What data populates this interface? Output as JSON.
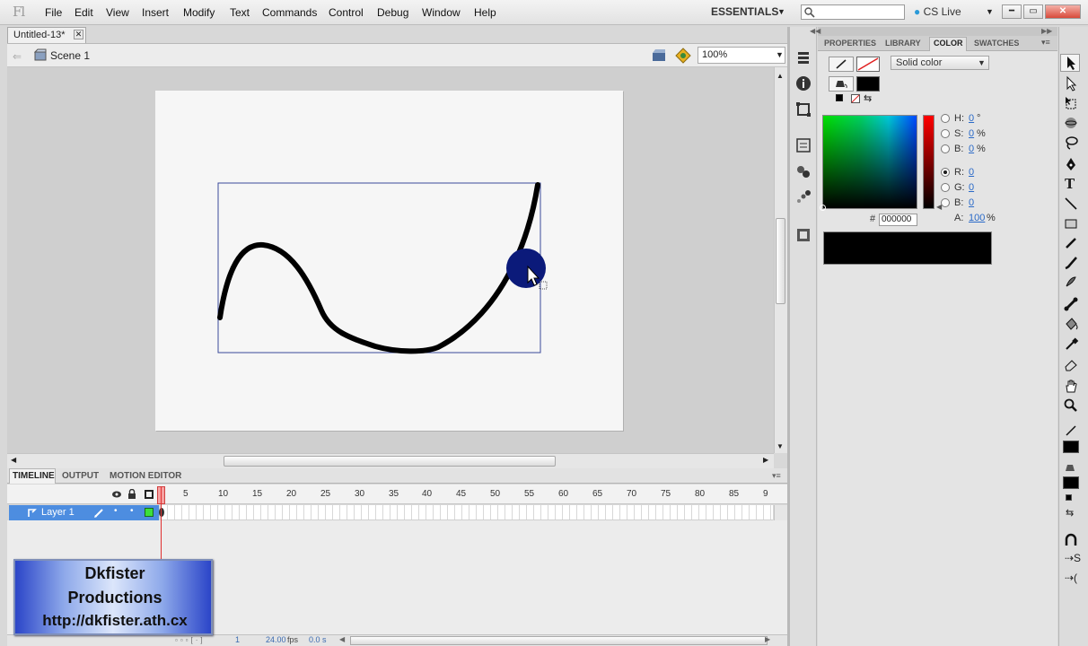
{
  "menubar": {
    "logo": "Fl",
    "items": [
      "File",
      "Edit",
      "View",
      "Insert",
      "Modify",
      "Text",
      "Commands",
      "Control",
      "Debug",
      "Window",
      "Help"
    ],
    "workspace": "ESSENTIALS",
    "cs_live": "CS Live"
  },
  "document": {
    "tab_title": "Untitled-13*",
    "scene": "Scene 1",
    "zoom": "100%"
  },
  "timeline": {
    "tabs": [
      "TIMELINE",
      "OUTPUT",
      "MOTION EDITOR"
    ],
    "ruler": [
      "5",
      "10",
      "15",
      "20",
      "25",
      "30",
      "35",
      "40",
      "45",
      "50",
      "55",
      "60",
      "65",
      "70",
      "75",
      "80",
      "85",
      "9"
    ],
    "layer_name": "Layer 1",
    "current_frame": "1",
    "fps": "24.00",
    "fps_unit": "fps",
    "time": "0.0 s"
  },
  "watermark": {
    "line1": "Dkfister",
    "line2": "Productions",
    "line3": "http://dkfister.ath.cx"
  },
  "panels": {
    "tabs": [
      "PROPERTIES",
      "LIBRARY",
      "COLOR",
      "SWATCHES"
    ],
    "color": {
      "type": "Solid color",
      "h_label": "H:",
      "h_value": "0",
      "h_unit": "°",
      "s_label": "S:",
      "s_value": "0",
      "s_unit": "%",
      "b_label": "B:",
      "b_value": "0",
      "b_unit": "%",
      "r_label": "R:",
      "r_value": "0",
      "g_label": "G:",
      "g_value": "0",
      "bl_label": "B:",
      "bl_value": "0",
      "hex_label": "#",
      "hex_value": "000000",
      "alpha_label": "A:",
      "alpha_value": "100",
      "alpha_unit": "%",
      "fill_color": "#000000",
      "stroke_color": "#ffffff"
    }
  },
  "stage": {
    "curve_color": "#000000",
    "circle_color": "#0b1a7a"
  }
}
